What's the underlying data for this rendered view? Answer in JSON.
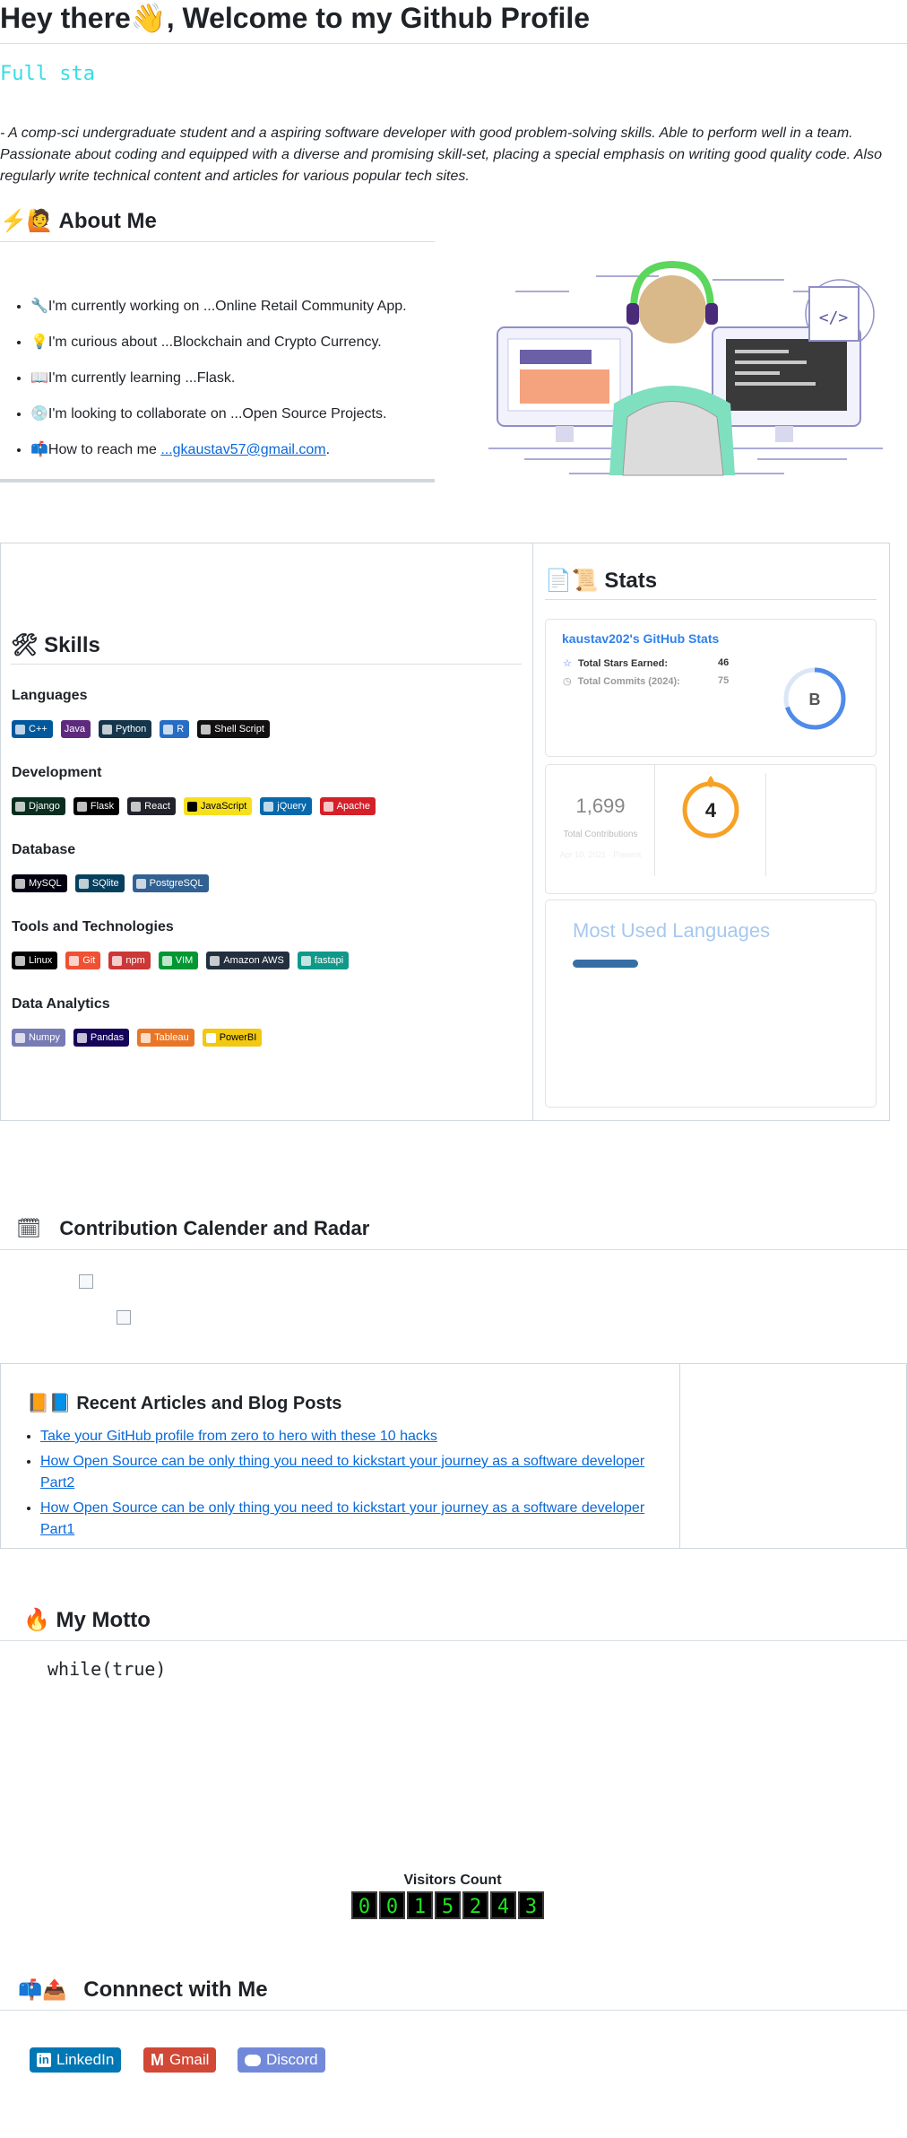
{
  "header": {
    "title": "Hey there👋, Welcome to my Github Profile",
    "typing_text": "Full sta",
    "intro": "- A comp-sci undergraduate student and a aspiring software developer with good problem-solving skills. Able to perform well in a team. Passionate about coding and equipped with a diverse and promising skill-set, placing a special emphasis on writing good quality code. Also regularly write technical content and articles for various popular tech sites."
  },
  "about": {
    "heading": "⚡🙋 About Me",
    "items": [
      {
        "icon": "🔧",
        "text": "I'm currently working on ...Online Retail Community App."
      },
      {
        "icon": "💡",
        "text": "I'm curious about ...Blockchain and Crypto Currency."
      },
      {
        "icon": "📖",
        "text": "I'm currently learning ...Flask."
      },
      {
        "icon": "💿",
        "text": "I'm looking to collaborate on ...Open Source Projects."
      },
      {
        "icon": "📫",
        "text": "How to reach me ",
        "link": "...gkaustav57@gmail.com",
        "suffix": "."
      }
    ]
  },
  "skills": {
    "heading": "🛠 Skills",
    "categories": [
      {
        "name": "Languages",
        "badges": [
          {
            "label": "C++",
            "color": "#00599C"
          },
          {
            "label": "Java",
            "color": "#5E2A7E"
          },
          {
            "label": "Python",
            "color": "#14354C"
          },
          {
            "label": "R",
            "color": "#276DC3"
          },
          {
            "label": "Shell Script",
            "color": "#121011"
          }
        ]
      },
      {
        "name": "Development",
        "badges": [
          {
            "label": "Django",
            "color": "#092E20"
          },
          {
            "label": "Flask",
            "color": "#000000"
          },
          {
            "label": "React",
            "color": "#20232a"
          },
          {
            "label": "JavaScript",
            "color": "#F7DF1E",
            "text": "#000000"
          },
          {
            "label": "jQuery",
            "color": "#0769AD"
          },
          {
            "label": "Apache",
            "color": "#D42029"
          }
        ]
      },
      {
        "name": "Database",
        "badges": [
          {
            "label": "MySQL",
            "color": "#00000f"
          },
          {
            "label": "SQlite",
            "color": "#07405e"
          },
          {
            "label": "PostgreSQL",
            "color": "#316192"
          }
        ]
      },
      {
        "name": "Tools and Technologies",
        "badges": [
          {
            "label": "Linux",
            "color": "#000000"
          },
          {
            "label": "Git",
            "color": "#F05033"
          },
          {
            "label": "npm",
            "color": "#CB3837"
          },
          {
            "label": "VIM",
            "color": "#019733"
          },
          {
            "label": "Amazon AWS",
            "color": "#232F3E"
          },
          {
            "label": "fastapi",
            "color": "#109989"
          }
        ]
      },
      {
        "name": "Data Analytics",
        "badges": [
          {
            "label": "Numpy",
            "color": "#777BB4"
          },
          {
            "label": "Pandas",
            "color": "#150458"
          },
          {
            "label": "Tableau",
            "color": "#E97627"
          },
          {
            "label": "PowerBI",
            "color": "#F2C811",
            "text": "#000000"
          }
        ]
      }
    ]
  },
  "stats": {
    "heading": "📄📜 Stats",
    "card_title": "kaustav202's GitHub Stats",
    "rows": [
      {
        "label": "Total Stars Earned:",
        "value": "46"
      },
      {
        "label": "Total Commits (2024):",
        "value": "75"
      }
    ],
    "rank": "B",
    "rank_fraction": 0.7,
    "total_contributions": "1,699",
    "total_contributions_label": "Total Contributions",
    "contrib_date": "Apr 10, 2021 - Present",
    "streak": "4",
    "langs_title": "Most Used Languages"
  },
  "calendar": {
    "heading": "Contribution Calender and Radar"
  },
  "articles": {
    "heading": "📙📘 Recent Articles and Blog Posts",
    "items": [
      "Take your GitHub profile from zero to hero with these 10 hacks",
      "How Open Source can be only thing you need to kickstart your journey as a software developer Part2",
      "How Open Source can be only thing you need to kickstart your journey as a software developer Part1"
    ]
  },
  "motto": {
    "heading": "🔥 My Motto",
    "code": "while(true)"
  },
  "visitors": {
    "label": "Visitors Count",
    "digits": [
      "0",
      "0",
      "1",
      "5",
      "2",
      "4",
      "3"
    ]
  },
  "connect": {
    "heading": "Connnect with Me",
    "buttons": [
      {
        "label": "LinkedIn",
        "color": "#0077B5",
        "icon": "linkedin-icon"
      },
      {
        "label": "Gmail",
        "color": "#D14836",
        "icon": "gmail-icon"
      },
      {
        "label": "Discord",
        "color": "#7289DA",
        "icon": "discord-icon"
      }
    ]
  }
}
